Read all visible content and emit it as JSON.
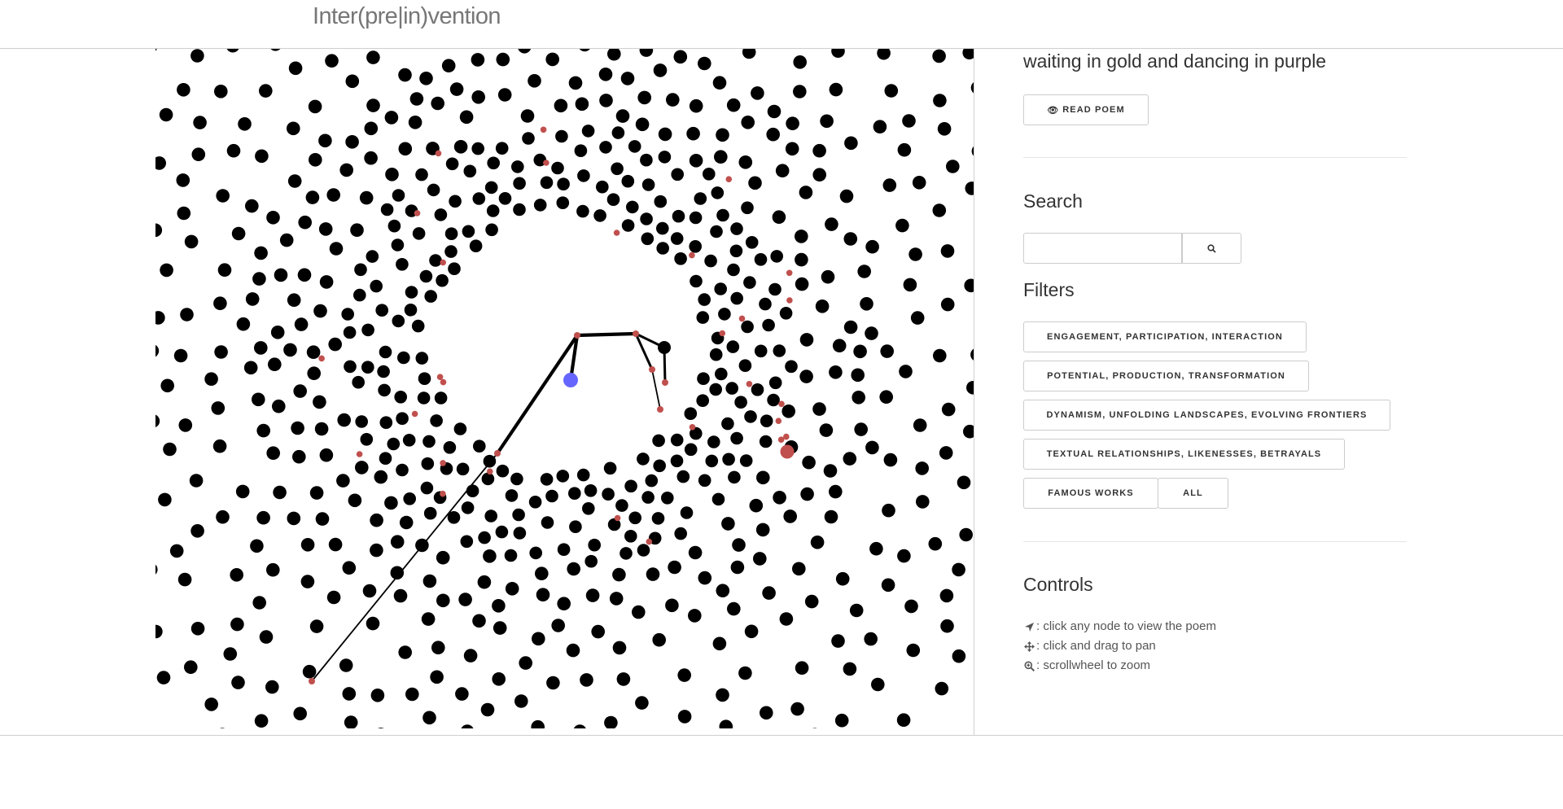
{
  "app": {
    "brand": "Inter(pre|in)vention"
  },
  "sidebar": {
    "poem_title": "waiting in gold and dancing in purple",
    "read_poem_label": "READ POEM",
    "read_poem_icon": "eye-icon",
    "search_heading": "Search",
    "search_input_value": "",
    "search_button_icon": "search-icon",
    "filters_heading": "Filters",
    "filters": [
      "ENGAGEMENT, PARTICIPATION, INTERACTION",
      "POTENTIAL, PRODUCTION, TRANSFORMATION",
      "DYNAMISM, UNFOLDING LANDSCAPES, EVOLVING FRONTIERS",
      "TEXTUAL RELATIONSHIPS, LIKENESSES, BETRAYALS",
      "FAMOUS WORKS",
      "ALL"
    ],
    "controls_heading": "Controls",
    "controls": [
      {
        "icon": "location-arrow-icon",
        "text": ": click any node to view the poem"
      },
      {
        "icon": "move-arrows-icon",
        "text": ": click and drag to pan"
      },
      {
        "icon": "zoom-in-icon",
        "text": ": scrollwheel to zoom"
      }
    ]
  },
  "graph": {
    "node_color": "#000000",
    "highlight_node_color": "#c0504d",
    "selected_node_color": "#6666ff"
  }
}
